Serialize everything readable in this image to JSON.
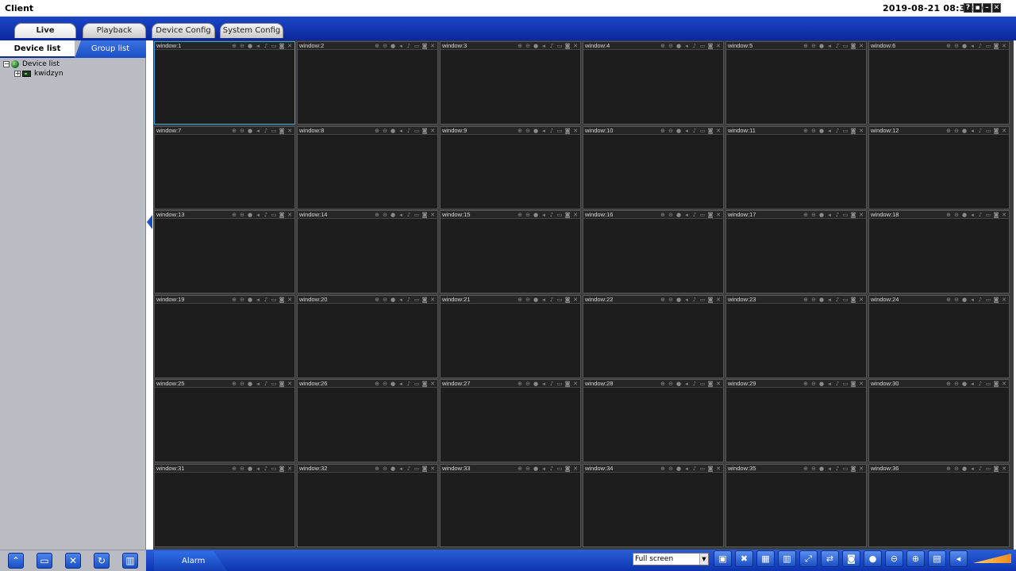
{
  "window": {
    "title": "Client",
    "datetime": "2019-08-21 08:33:50",
    "buttons": [
      "?",
      "▪",
      "–",
      "✕"
    ]
  },
  "main_tabs": [
    "Live",
    "Playback",
    "Device Config",
    "System Config"
  ],
  "active_main_tab": "Live",
  "sidebar": {
    "tabs": [
      "Device list",
      "Group list"
    ],
    "active_tab": "Device list",
    "tree": {
      "root": "Device list",
      "children": [
        "kwidzyn"
      ]
    }
  },
  "grid": {
    "selected_window": "window:1",
    "windows": [
      "window:1",
      "window:2",
      "window:3",
      "window:4",
      "window:5",
      "window:6",
      "window:7",
      "window:8",
      "window:9",
      "window:10",
      "window:11",
      "window:12",
      "window:13",
      "window:14",
      "window:15",
      "window:16",
      "window:17",
      "window:18",
      "window:19",
      "window:20",
      "window:21",
      "window:22",
      "window:23",
      "window:24",
      "window:25",
      "window:26",
      "window:27",
      "window:28",
      "window:29",
      "window:30",
      "window:31",
      "window:32",
      "window:33",
      "window:34",
      "window:35",
      "window:36"
    ],
    "window_icons": [
      "zoom-in-icon",
      "zoom-out-icon",
      "record-icon",
      "volume-icon",
      "audio-icon",
      "square-icon",
      "camera-icon",
      "close-icon"
    ]
  },
  "bottombar": {
    "alarm_label": "Alarm",
    "screen_mode": "Full screen",
    "left_tools": [
      "menu-icon",
      "monitor-icon",
      "tools-icon",
      "refresh-icon",
      "color-icon"
    ],
    "right_tools": [
      "stop-all-icon",
      "close-all-icon",
      "layout-icon",
      "grid-icon",
      "fullscreen-icon",
      "sequence-icon",
      "snapshot-icon",
      "record-icon",
      "zoom-out-icon",
      "zoom-in-icon",
      "split-icon",
      "mute-icon"
    ]
  },
  "colors": {
    "brand_blue": "#1a4fc4",
    "dark_blue": "#0c2aa0",
    "selected_border": "#39a6e6",
    "cell_bg": "#1d1d1d",
    "sidebar_bg": "#b9bcc3"
  }
}
